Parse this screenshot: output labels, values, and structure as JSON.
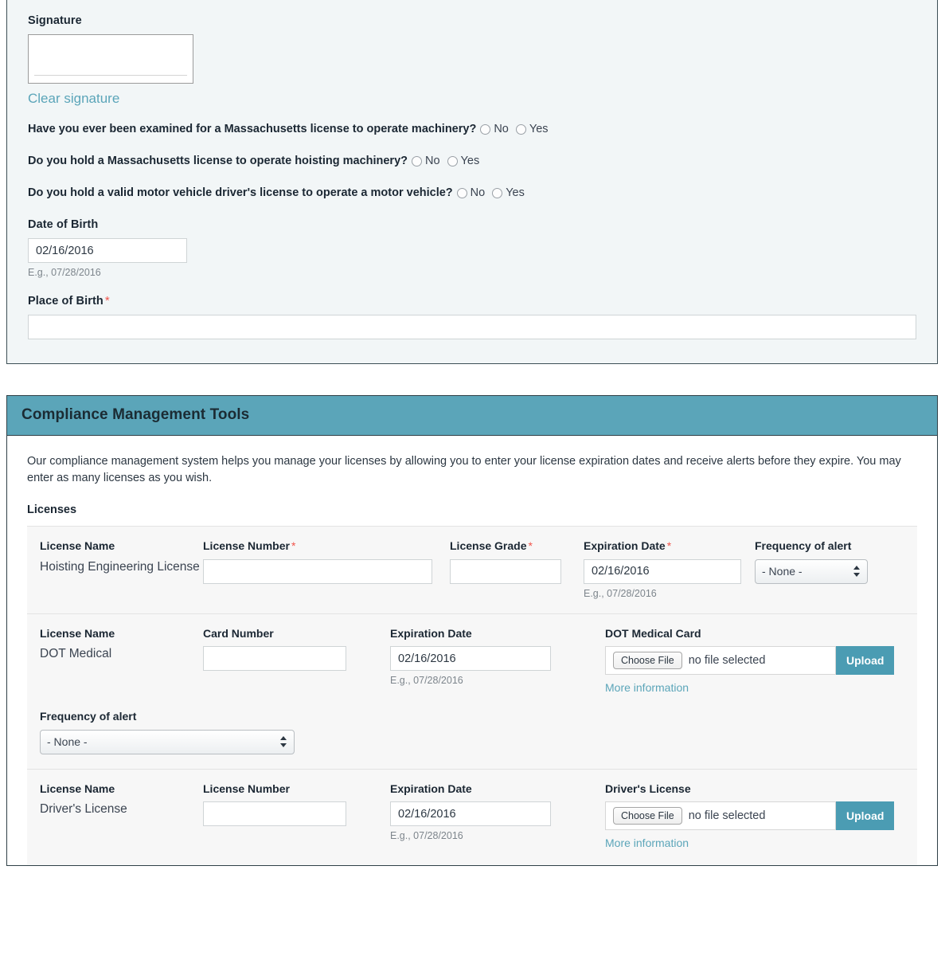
{
  "application_form": {
    "signature": {
      "label": "Signature",
      "clear_link": "Clear signature"
    },
    "questions": [
      {
        "text": "Have you ever been examined for a Massachusetts license to operate machinery?",
        "options": [
          "No",
          "Yes"
        ],
        "selected": null
      },
      {
        "text": "Do you hold a Massachusetts license to operate hoisting machinery?",
        "options": [
          "No",
          "Yes"
        ],
        "selected": null
      },
      {
        "text": "Do you hold a valid motor vehicle driver's license to operate a motor vehicle?",
        "options": [
          "No",
          "Yes"
        ],
        "selected": null
      }
    ],
    "date_of_birth": {
      "label": "Date of Birth",
      "value": "02/16/2016",
      "hint": "E.g., 07/28/2016"
    },
    "place_of_birth": {
      "label": "Place of Birth",
      "required_marker": "*",
      "value": ""
    }
  },
  "compliance": {
    "header_title": "Compliance Management Tools",
    "intro": "Our compliance management system helps you manage your licenses by allowing you to enter your license expiration dates and receive alerts before they expire. You may enter as many licenses as you wish.",
    "section_title": "Licenses",
    "labels": {
      "license_name": "License Name",
      "license_number": "License Number",
      "card_number": "Card Number",
      "license_grade": "License Grade",
      "expiration_date": "Expiration Date",
      "frequency_of_alert": "Frequency of alert",
      "required_marker": "*",
      "date_hint": "E.g., 07/28/2016",
      "choose_file": "Choose File",
      "no_file_selected": "no file selected",
      "upload": "Upload",
      "more_information": "More information",
      "select_none": "- None -"
    },
    "rows": [
      {
        "name": "Hoisting Engineering License",
        "number_label": "License Number",
        "number_value": "",
        "grade_label": "License Grade",
        "grade_value": "",
        "expiration_label": "Expiration Date",
        "expiration_value": "02/16/2016",
        "date_hint": "E.g., 07/28/2016",
        "frequency_label": "Frequency of alert",
        "frequency_value": "- None -"
      },
      {
        "name": "DOT Medical",
        "number_label": "Card Number",
        "number_value": "",
        "expiration_label": "Expiration Date",
        "expiration_value": "02/16/2016",
        "date_hint": "E.g., 07/28/2016",
        "upload_label": "DOT Medical Card",
        "file_status": "no file selected",
        "more_information": "More information",
        "frequency_label": "Frequency of alert",
        "frequency_value": "- None -"
      },
      {
        "name": "Driver's License",
        "number_label": "License Number",
        "number_value": "",
        "expiration_label": "Expiration Date",
        "expiration_value": "02/16/2016",
        "date_hint": "E.g., 07/28/2016",
        "upload_label": "Driver's License",
        "file_status": "no file selected",
        "more_information": "More information"
      }
    ]
  },
  "colors": {
    "accent_teal": "#5BA5B9",
    "upload_button": "#4B9CB3",
    "required_red": "#F1554C",
    "panel_bg": "#F2F6F7",
    "row_bg": "#F7F7F7"
  }
}
